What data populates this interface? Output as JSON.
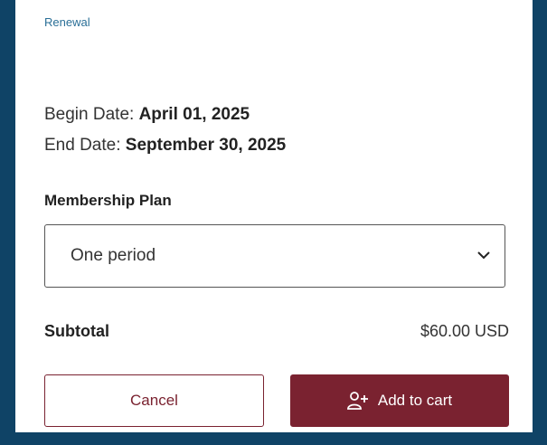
{
  "header": {
    "renewal_label": "Renewal"
  },
  "dates": {
    "begin_label": "Begin Date:",
    "begin_value": "April 01, 2025",
    "end_label": "End Date:",
    "end_value": "September 30, 2025"
  },
  "plan": {
    "label": "Membership Plan",
    "selected": "One period"
  },
  "summary": {
    "subtotal_label": "Subtotal",
    "subtotal_value": "$60.00 USD"
  },
  "actions": {
    "cancel_label": "Cancel",
    "add_to_cart_label": "Add to cart"
  },
  "colors": {
    "accent": "#7a2230",
    "link": "#2a6f97",
    "background": "#0f4366"
  },
  "icons": {
    "dropdown": "chevron-down-icon",
    "cart_button": "add-user-icon"
  }
}
